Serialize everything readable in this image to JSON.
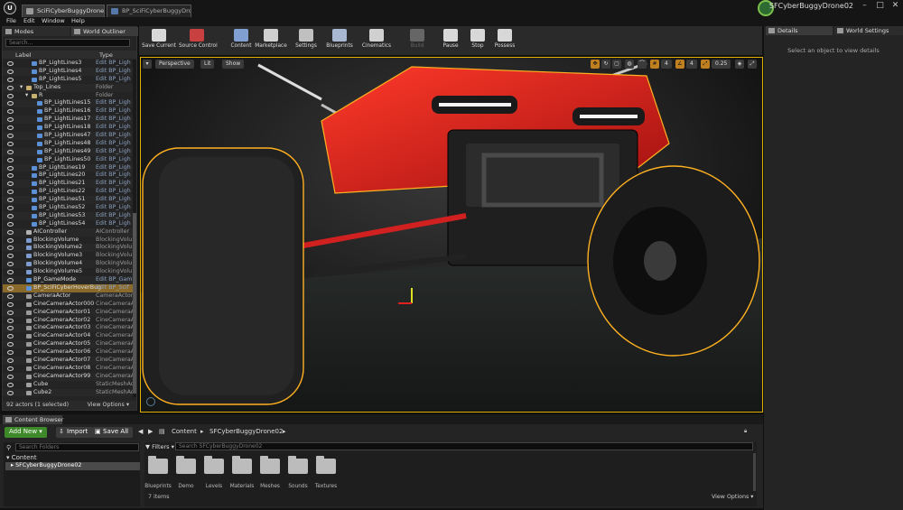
{
  "titlebar": {
    "tabs": [
      "SciFiCyberBuggyDrone_JEMM",
      "BP_SciFiCyberBuggyDron"
    ],
    "project": "SFCyberBuggyDrone02",
    "window_buttons": [
      "–",
      "□",
      "✕"
    ]
  },
  "menu": [
    "File",
    "Edit",
    "Window",
    "Help"
  ],
  "left_panel": {
    "tabs": [
      "Modes",
      "World Outliner"
    ],
    "search_placeholder": "Search...",
    "columns": {
      "label": "Label",
      "type": "Type"
    },
    "rows": [
      {
        "label": "BP_LightLines3",
        "type": "Edit BP_Ligh",
        "indent": 1,
        "kind": "bp"
      },
      {
        "label": "BP_LightLines4",
        "type": "Edit BP_Ligh",
        "indent": 1,
        "kind": "bp"
      },
      {
        "label": "BP_LightLines5",
        "type": "Edit BP_Ligh",
        "indent": 1,
        "kind": "bp"
      },
      {
        "label": "Top_Lines",
        "type": "Folder",
        "indent": 0,
        "kind": "folder",
        "expander": "▾"
      },
      {
        "label": "R",
        "type": "Folder",
        "indent": 1,
        "kind": "folder",
        "expander": "▾"
      },
      {
        "label": "BP_LightLines15",
        "type": "Edit BP_Ligh",
        "indent": 2,
        "kind": "bp"
      },
      {
        "label": "BP_LightLines16",
        "type": "Edit BP_Ligh",
        "indent": 2,
        "kind": "bp"
      },
      {
        "label": "BP_LightLines17",
        "type": "Edit BP_Ligh",
        "indent": 2,
        "kind": "bp"
      },
      {
        "label": "BP_LightLines18",
        "type": "Edit BP_Ligh",
        "indent": 2,
        "kind": "bp"
      },
      {
        "label": "BP_LightLines47",
        "type": "Edit BP_Ligh",
        "indent": 2,
        "kind": "bp"
      },
      {
        "label": "BP_LightLines48",
        "type": "Edit BP_Ligh",
        "indent": 2,
        "kind": "bp"
      },
      {
        "label": "BP_LightLines49",
        "type": "Edit BP_Ligh",
        "indent": 2,
        "kind": "bp"
      },
      {
        "label": "BP_LightLines50",
        "type": "Edit BP_Ligh",
        "indent": 2,
        "kind": "bp"
      },
      {
        "label": "BP_LightLines19",
        "type": "Edit BP_Ligh",
        "indent": 1,
        "kind": "bp"
      },
      {
        "label": "BP_LightLines20",
        "type": "Edit BP_Ligh",
        "indent": 1,
        "kind": "bp"
      },
      {
        "label": "BP_LightLines21",
        "type": "Edit BP_Ligh",
        "indent": 1,
        "kind": "bp"
      },
      {
        "label": "BP_LightLines22",
        "type": "Edit BP_Ligh",
        "indent": 1,
        "kind": "bp"
      },
      {
        "label": "BP_LightLines51",
        "type": "Edit BP_Ligh",
        "indent": 1,
        "kind": "bp"
      },
      {
        "label": "BP_LightLines52",
        "type": "Edit BP_Ligh",
        "indent": 1,
        "kind": "bp"
      },
      {
        "label": "BP_LightLines53",
        "type": "Edit BP_Ligh",
        "indent": 1,
        "kind": "bp"
      },
      {
        "label": "BP_LightLines54",
        "type": "Edit BP_Ligh",
        "indent": 1,
        "kind": "bp"
      },
      {
        "label": "AIController",
        "type": "AIController",
        "indent": 0,
        "kind": "actor"
      },
      {
        "label": "BlockingVolume",
        "type": "BlockingVolu",
        "indent": 0,
        "kind": "volume"
      },
      {
        "label": "BlockingVolume2",
        "type": "BlockingVolu",
        "indent": 0,
        "kind": "volume"
      },
      {
        "label": "BlockingVolume3",
        "type": "BlockingVolu",
        "indent": 0,
        "kind": "volume"
      },
      {
        "label": "BlockingVolume4",
        "type": "BlockingVolu",
        "indent": 0,
        "kind": "volume"
      },
      {
        "label": "BlockingVolume5",
        "type": "BlockingVolu",
        "indent": 0,
        "kind": "volume"
      },
      {
        "label": "BP_GameMode",
        "type": "Edit BP_Gam",
        "indent": 0,
        "kind": "bp"
      },
      {
        "label": "BP_SciFiCyberHoverBug",
        "type": "Edit BP_Scif",
        "indent": 0,
        "kind": "bp",
        "selected": true
      },
      {
        "label": "CameraActor",
        "type": "CameraActor",
        "indent": 0,
        "kind": "camera"
      },
      {
        "label": "CineCameraActor000",
        "type": "CineCameraA",
        "indent": 0,
        "kind": "camera"
      },
      {
        "label": "CineCameraActor01",
        "type": "CineCameraA",
        "indent": 0,
        "kind": "camera"
      },
      {
        "label": "CineCameraActor02",
        "type": "CineCameraA",
        "indent": 0,
        "kind": "camera"
      },
      {
        "label": "CineCameraActor03",
        "type": "CineCameraA",
        "indent": 0,
        "kind": "camera"
      },
      {
        "label": "CineCameraActor04",
        "type": "CineCameraA",
        "indent": 0,
        "kind": "camera"
      },
      {
        "label": "CineCameraActor05",
        "type": "CineCameraA",
        "indent": 0,
        "kind": "camera"
      },
      {
        "label": "CineCameraActor06",
        "type": "CineCameraA",
        "indent": 0,
        "kind": "camera"
      },
      {
        "label": "CineCameraActor07",
        "type": "CineCameraA",
        "indent": 0,
        "kind": "camera"
      },
      {
        "label": "CineCameraActor08",
        "type": "CineCameraA",
        "indent": 0,
        "kind": "camera"
      },
      {
        "label": "CineCameraActor99",
        "type": "CineCameraA",
        "indent": 0,
        "kind": "camera"
      },
      {
        "label": "Cube",
        "type": "StaticMeshAc",
        "indent": 0,
        "kind": "mesh"
      },
      {
        "label": "Cube2",
        "type": "StaticMeshAc",
        "indent": 0,
        "kind": "mesh"
      }
    ],
    "footer_count": "92 actors (1 selected)",
    "footer_view_options": "View Options ▾"
  },
  "toolbar": [
    {
      "label": "Save Current",
      "icon": "save-icon",
      "color": "#d8d8d8"
    },
    {
      "label": "Source Control",
      "icon": "source-control-icon",
      "color": "#c84040"
    },
    {
      "label": "Content",
      "icon": "content-icon",
      "color": "#7fa0d0"
    },
    {
      "label": "Marketplace",
      "icon": "marketplace-icon",
      "color": "#d0d0d0"
    },
    {
      "label": "Settings",
      "icon": "gear-icon",
      "color": "#c0c0c0"
    },
    {
      "label": "Blueprints",
      "icon": "blueprints-icon",
      "color": "#a8b8d0"
    },
    {
      "label": "Cinematics",
      "icon": "clapper-icon",
      "color": "#d0d0d0"
    },
    {
      "label": "Build",
      "icon": "build-icon",
      "color": "#666666",
      "disabled": true
    },
    {
      "label": "Pause",
      "icon": "pause-icon",
      "color": "#d8d8d8"
    },
    {
      "label": "Stop",
      "icon": "stop-icon",
      "color": "#d8d8d8"
    },
    {
      "label": "Possess",
      "icon": "possess-icon",
      "color": "#d8d8d8"
    }
  ],
  "viewport": {
    "perspective": "Perspective",
    "lit": "Lit",
    "show": "Show",
    "snap_value": "0.25",
    "grid_value": "4"
  },
  "details": {
    "tabs": [
      "Details",
      "World Settings"
    ],
    "empty_message": "Select an object to view details"
  },
  "content_browser": {
    "tab": "Content Browser",
    "add_new": "Add New ▾",
    "import": "Import",
    "save_all": "Save All",
    "breadcrumb": [
      "Content",
      "SFCyberBuggyDrone02"
    ],
    "search_folders_placeholder": "Search Folders",
    "filters": "Filters ▾",
    "search_placeholder": "Search SFCyberBuggyDrone02",
    "tree": [
      "Content",
      "SFCyberBuggyDrone02"
    ],
    "folders": [
      "Blueprints",
      "Demo",
      "Levels",
      "Materials",
      "Meshes",
      "Sounds",
      "Textures"
    ],
    "count": "7 items",
    "view_options": "View Options ▾"
  }
}
